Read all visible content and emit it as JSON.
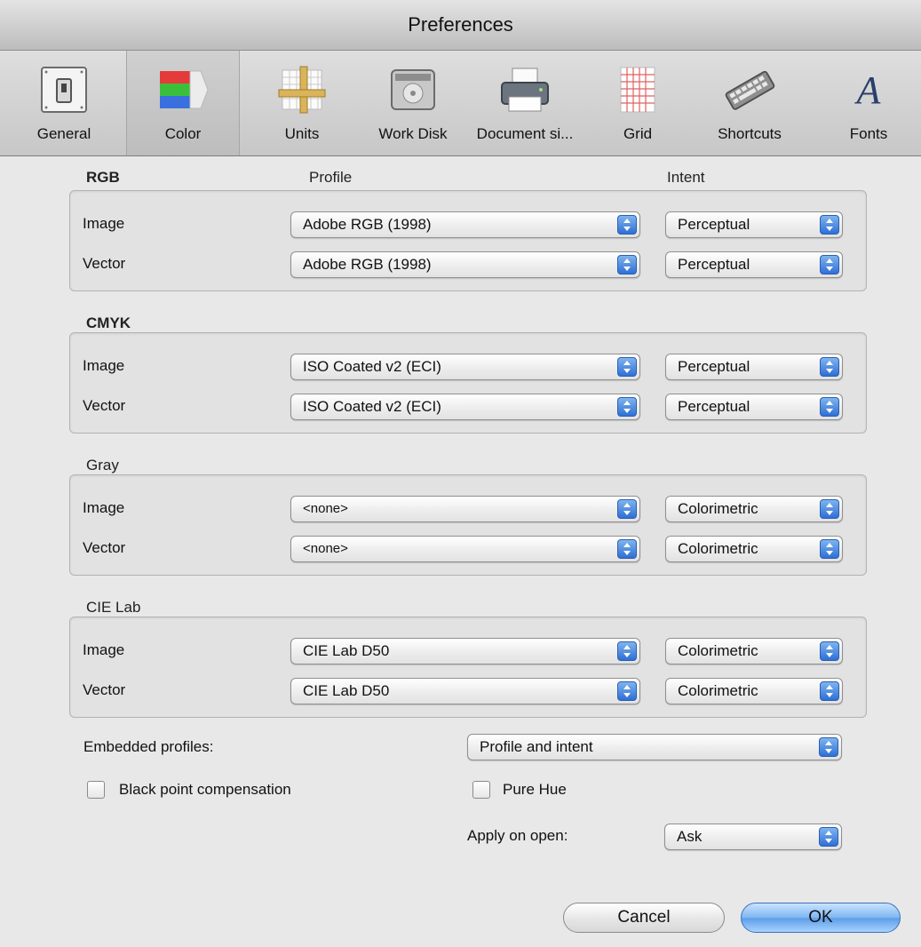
{
  "window": {
    "title": "Preferences"
  },
  "toolbar": {
    "items": [
      {
        "label": "General",
        "icon": "switch-icon"
      },
      {
        "label": "Color",
        "icon": "color-bars-icon",
        "selected": true
      },
      {
        "label": "Units",
        "icon": "ruler-grid-icon"
      },
      {
        "label": "Work Disk",
        "icon": "hard-disk-icon"
      },
      {
        "label": "Document si...",
        "icon": "printer-icon"
      },
      {
        "label": "Grid",
        "icon": "grid-page-icon"
      },
      {
        "label": "Shortcuts",
        "icon": "keyboard-icon"
      },
      {
        "label": "Fonts",
        "icon": "font-a-icon"
      }
    ]
  },
  "columns": {
    "profile": "Profile",
    "intent": "Intent"
  },
  "sections": [
    {
      "title": "RGB",
      "rows": [
        {
          "label": "Image",
          "profile": "Adobe RGB (1998)",
          "intent": "Perceptual"
        },
        {
          "label": "Vector",
          "profile": "Adobe RGB (1998)",
          "intent": "Perceptual"
        }
      ]
    },
    {
      "title": "CMYK",
      "rows": [
        {
          "label": "Image",
          "profile": "ISO Coated v2 (ECI)",
          "intent": "Perceptual"
        },
        {
          "label": "Vector",
          "profile": "ISO Coated v2 (ECI)",
          "intent": "Perceptual"
        }
      ]
    },
    {
      "title": "Gray",
      "rows": [
        {
          "label": "Image",
          "profile": "<none>",
          "intent": "Colorimetric"
        },
        {
          "label": "Vector",
          "profile": "<none>",
          "intent": "Colorimetric"
        }
      ]
    },
    {
      "title": "CIE Lab",
      "rows": [
        {
          "label": "Image",
          "profile": "CIE Lab D50",
          "intent": "Colorimetric"
        },
        {
          "label": "Vector",
          "profile": "CIE Lab D50",
          "intent": "Colorimetric"
        }
      ]
    }
  ],
  "embedded": {
    "label": "Embedded profiles:",
    "value": "Profile and intent"
  },
  "options": {
    "black_point": {
      "label": "Black point compensation",
      "checked": false
    },
    "pure_hue": {
      "label": "Pure Hue",
      "checked": false
    },
    "apply_on_open": {
      "label": "Apply on open:",
      "value": "Ask"
    }
  },
  "buttons": {
    "cancel": "Cancel",
    "ok": "OK"
  },
  "colors": {
    "accent": "#3a7be0",
    "window_bg": "#e8e8e8"
  }
}
